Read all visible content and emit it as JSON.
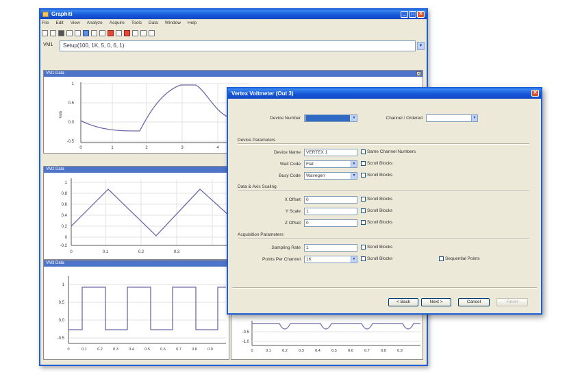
{
  "main_window": {
    "title": "Graphiti",
    "menu": [
      "File",
      "Edit",
      "View",
      "Analyze",
      "Acquire",
      "Tools",
      "Data",
      "Window",
      "Help"
    ],
    "command_label": "VM1",
    "command_value": "Setup(100, 1K, 5, 0, 6, 1)",
    "colors": {
      "title_bar": "#1656d8",
      "panel_title": "#4d74c9",
      "series": "#6a6aa8"
    }
  },
  "plots": [
    {
      "title": "VM1 Data",
      "ylabel": "Volts",
      "yticks": [
        "1",
        "0.5",
        "0.0",
        "-0.5"
      ],
      "xticks": [
        "0",
        "1",
        "2",
        "3",
        "4"
      ]
    },
    {
      "title": "VM2 Data",
      "yticks": [
        "1",
        "0.8",
        "0.6",
        "0.4",
        "0.2",
        "0",
        "-0.2"
      ],
      "xticks": [
        "0",
        "0.1",
        "0.2",
        "0.3"
      ]
    },
    {
      "title": "VM3 Data",
      "yticks": [
        "1",
        "0.5",
        "0.0",
        "-0.5"
      ],
      "xticks": [
        "0",
        "0.1",
        "0.2",
        "0.3",
        "0.4",
        "0.5",
        "0.6",
        "0.7",
        "0.8",
        "0.9"
      ]
    },
    {
      "yticks": [
        "-0.5",
        "-1.0"
      ],
      "xticks": [
        "0",
        "0.1",
        "0.2",
        "0.3",
        "0.4",
        "0.5",
        "0.6",
        "0.7",
        "0.8",
        "0.9"
      ]
    }
  ],
  "dialog": {
    "title": "Vertex Voltmeter (Out 3)",
    "device_number_label": "Device Number",
    "device_number_value": "",
    "channel_label": "Channel / Ordered",
    "channel_value": "",
    "device_section": "Device Parameters",
    "device_name_label": "Device Name",
    "device_name_value": "VERTEX 1",
    "same_channel_label": "Same Channel Numbers",
    "wait_code_label": "Wait Code",
    "wait_code_value": "Flat",
    "scroll_label": "Scroll Blocks",
    "busy_code_label": "Busy Code",
    "busy_code_value": "Wavegen",
    "data_section": "Data & Axis Scaling",
    "x_offset_label": "X Offset",
    "x_offset_value": "0",
    "y_scale_label": "Y Scale",
    "y_scale_value": "1",
    "z_offset_label": "Z Offset",
    "z_offset_value": "0",
    "acq_section": "Acquisition Parameters",
    "sampling_rate_label": "Sampling Rate",
    "sampling_rate_value": "1",
    "points_label": "Points Per Channel",
    "points_value": "1K",
    "sequential_label": "Sequential Points",
    "buttons": {
      "back": "< Back",
      "next": "Next >",
      "cancel": "Cancel",
      "finish": "Finish"
    }
  }
}
